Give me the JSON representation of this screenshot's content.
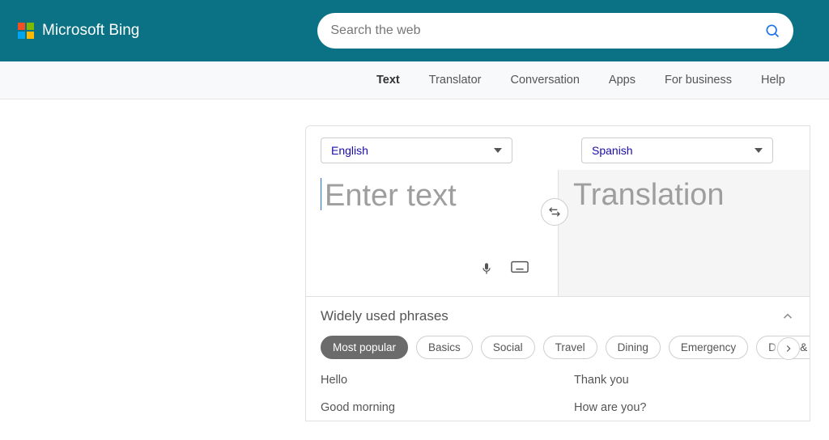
{
  "header": {
    "brand": "Microsoft Bing",
    "search_placeholder": "Search the web"
  },
  "tabs": {
    "text": "Text",
    "translator": "Translator",
    "conversation": "Conversation",
    "apps": "Apps",
    "business": "For business",
    "help": "Help"
  },
  "languages": {
    "source": "English",
    "target": "Spanish"
  },
  "panes": {
    "input_placeholder": "Enter text",
    "output_placeholder": "Translation"
  },
  "phrases": {
    "title": "Widely used phrases",
    "categories": {
      "popular": "Most popular",
      "basics": "Basics",
      "social": "Social",
      "travel": "Travel",
      "dining": "Dining",
      "emergency": "Emergency",
      "dates": "Dates & num"
    },
    "items": {
      "hello": "Hello",
      "thankyou": "Thank you",
      "goodmorning": "Good morning",
      "howareyou": "How are you?"
    }
  }
}
